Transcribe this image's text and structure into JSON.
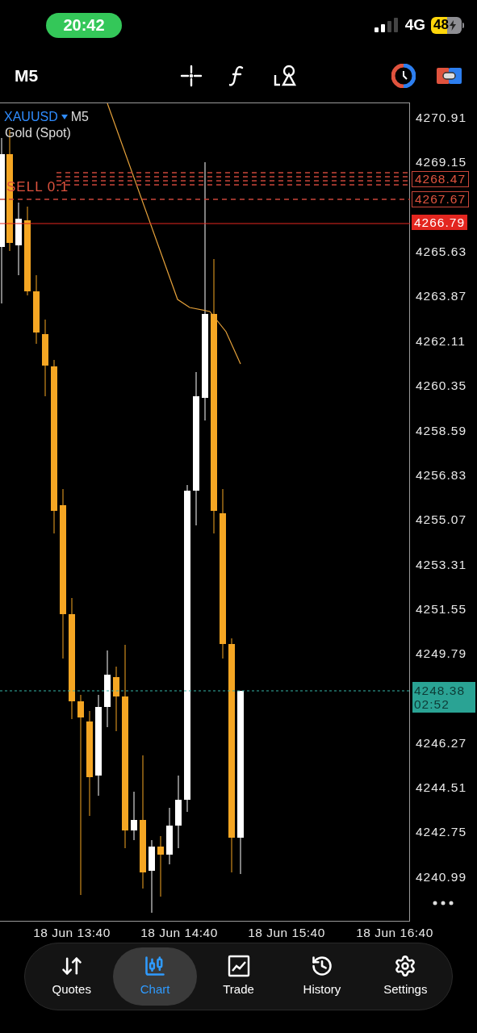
{
  "status_bar": {
    "time": "20:42",
    "network": "4G",
    "battery": "48"
  },
  "toolbar": {
    "timeframe": "M5"
  },
  "chart": {
    "symbol": "XAUUSD",
    "timeframe": "M5",
    "description": "Gold (Spot)",
    "order_label": "SELL 0.1",
    "axis_ticks": [
      "4270.91",
      "4269.15",
      "4265.63",
      "4263.87",
      "4262.11",
      "4260.35",
      "4258.59",
      "4256.83",
      "4255.07",
      "4253.31",
      "4251.55",
      "4249.79",
      "4246.27",
      "4244.51",
      "4242.75",
      "4240.99"
    ],
    "order_prices": [
      "4268.47",
      "4267.67"
    ],
    "bid_price": "4266.79",
    "current_price": "4248.38",
    "countdown": "02:52",
    "time_labels": [
      "18 Jun 13:40",
      "18 Jun 14:40",
      "18 Jun 15:40",
      "18 Jun 16:40"
    ]
  },
  "nav": [
    {
      "label": "Quotes",
      "selected": false,
      "kind": "quotes"
    },
    {
      "label": "Chart",
      "selected": true,
      "kind": "chart"
    },
    {
      "label": "Trade",
      "selected": false,
      "kind": "trade"
    },
    {
      "label": "History",
      "selected": false,
      "kind": "history"
    },
    {
      "label": "Settings",
      "selected": false,
      "kind": "settings"
    }
  ]
}
